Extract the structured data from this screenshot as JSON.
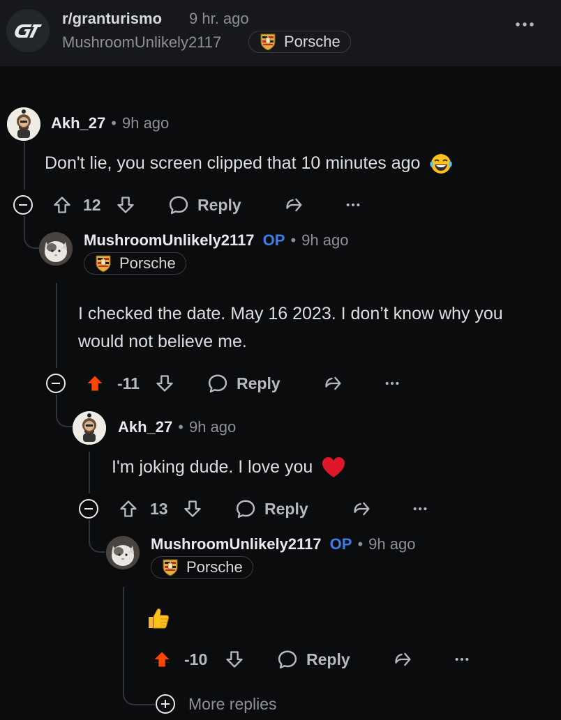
{
  "post": {
    "subreddit": "r/granturismo",
    "time": "9 hr. ago",
    "author": "MushroomUnlikely2117",
    "flair": "Porsche"
  },
  "comments": [
    {
      "author": "Akh_27",
      "time": "9h ago",
      "text": "Don't lie, you screen clipped that 10 minutes ago",
      "emoji": "laughing-tears",
      "score": "12",
      "vote": "none",
      "reply_label": "Reply"
    },
    {
      "author": "MushroomUnlikely2117",
      "op_tag": "OP",
      "time": "9h ago",
      "flair": "Porsche",
      "text": "I checked the date. May 16 2023. I don’t know why you would not believe me.",
      "score": "-11",
      "vote": "up",
      "reply_label": "Reply"
    },
    {
      "author": "Akh_27",
      "time": "9h ago",
      "text": "I'm joking dude. I love you",
      "emoji": "red-heart",
      "score": "13",
      "vote": "none",
      "reply_label": "Reply"
    },
    {
      "author": "MushroomUnlikely2117",
      "op_tag": "OP",
      "time": "9h ago",
      "flair": "Porsche",
      "text": "",
      "emoji": "thumbs-up",
      "score": "-10",
      "vote": "up",
      "reply_label": "Reply"
    }
  ],
  "more_replies": "More replies",
  "colors": {
    "accent_op": "#3d7de8",
    "upvote_active": "#ff4500",
    "background": "#0b0c0e"
  }
}
